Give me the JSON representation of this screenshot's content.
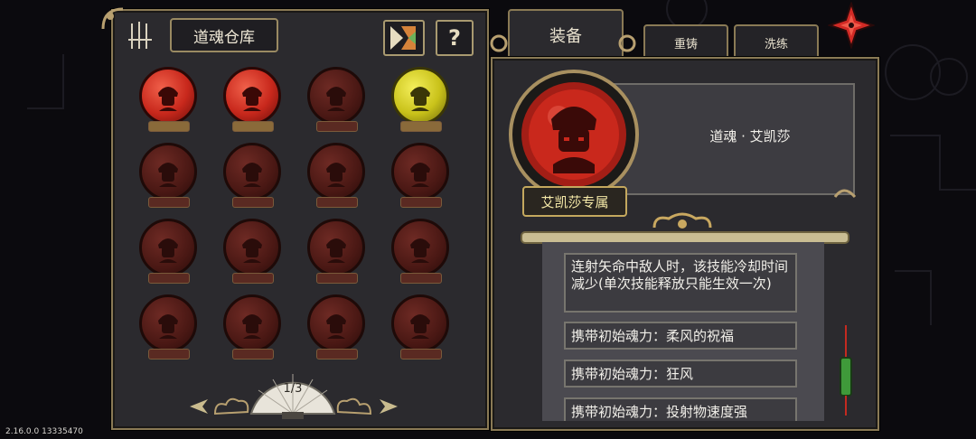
{
  "warehouse": {
    "title": "道魂仓库",
    "page_indicator": "1/3"
  },
  "tabs": {
    "equip": "装备",
    "recast": "重铸",
    "refine": "洗练"
  },
  "detail": {
    "name": "道魂 · 艾凯莎",
    "exclusive_tag": "艾凯莎专属",
    "descriptions": [
      "连射矢命中敌人时，该技能冷却时间减少(单次技能释放只能生效一次)",
      "携带初始魂力：柔风的祝福",
      "携带初始魂力：狂风",
      "携带初始魂力：投射物速度强"
    ]
  },
  "version": "2.16.0.0 13335470",
  "help_label": "?",
  "colors": {
    "panel_border": "#8a7a55",
    "orb_red": "#c8281c",
    "orb_gold": "#c9c21a",
    "orb_dim": "#5a1c18"
  },
  "orbs": [
    {
      "state": "active",
      "color": "red"
    },
    {
      "state": "active",
      "color": "red"
    },
    {
      "state": "locked",
      "color": "red"
    },
    {
      "state": "active",
      "color": "gold"
    },
    {
      "state": "locked",
      "color": "red"
    },
    {
      "state": "locked",
      "color": "red"
    },
    {
      "state": "locked",
      "color": "red"
    },
    {
      "state": "locked",
      "color": "red"
    },
    {
      "state": "locked",
      "color": "red"
    },
    {
      "state": "locked",
      "color": "red"
    },
    {
      "state": "locked",
      "color": "red"
    },
    {
      "state": "locked",
      "color": "red"
    },
    {
      "state": "locked",
      "color": "red"
    },
    {
      "state": "locked",
      "color": "red"
    },
    {
      "state": "locked",
      "color": "red"
    },
    {
      "state": "locked",
      "color": "red"
    }
  ]
}
